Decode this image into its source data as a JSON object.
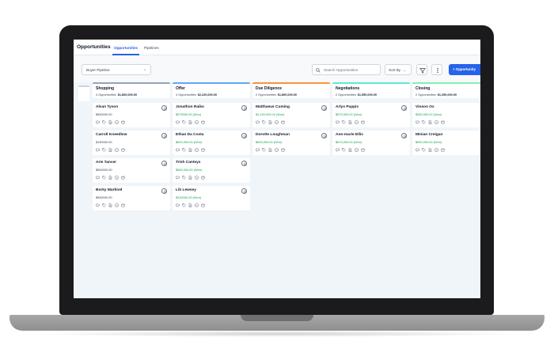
{
  "app": {
    "title": "Opportunities",
    "tabs": [
      {
        "label": "Opportunities",
        "active": true
      },
      {
        "label": "Pipelines",
        "active": false
      }
    ]
  },
  "toolbar": {
    "pipeline_select": "Buyer Pipeline",
    "search_placeholder": "Search Opportunities",
    "sort_label": "Sort By",
    "primary_label": "+ Opportunity"
  },
  "colors": {
    "accent": "#2563eb",
    "won": "#16a34a"
  },
  "card_icons": [
    "chat-icon",
    "tag-icon",
    "document-icon",
    "checkbox-icon",
    "calendar-icon"
  ],
  "columns": [
    {
      "name": "Shopping",
      "count": "4 Opportunities",
      "total": "$1,800,000.00",
      "color": "#94a3b8",
      "cards": [
        {
          "name": "Alvan Tyson",
          "amount": "$550000.00",
          "won": false
        },
        {
          "name": "Carroll Kneedlow",
          "amount": "$150000.00",
          "won": false
        },
        {
          "name": "Arie Tancer",
          "amount": "$550000.00",
          "won": false
        },
        {
          "name": "Borky Martinel",
          "amount": "$550000.00",
          "won": false
        }
      ]
    },
    {
      "name": "Offer",
      "count": "4 Opportunities",
      "total": "$2,220,000.00",
      "color": "#60a5fa",
      "cards": [
        {
          "name": "Jonathon Raiko",
          "amount": "$575000.00 (Won)",
          "won": true
        },
        {
          "name": "Ethan Da Costa",
          "amount": "$820,000.00 (Won)",
          "won": true
        },
        {
          "name": "Trish Canteys",
          "amount": "$550,000.00 (Won)",
          "won": true
        },
        {
          "name": "Lib Lewsey",
          "amount": "$240000.00 (Won)",
          "won": true
        }
      ]
    },
    {
      "name": "Due Diligence",
      "count": "2 Opportunities",
      "total": "$1,800,000.00",
      "color": "#fb923c",
      "cards": [
        {
          "name": "Matthaeus Cuming",
          "amount": "$1,200,000.00 (Won)",
          "won": true
        },
        {
          "name": "Dorotte Loughman",
          "amount": "$600,000.00 (Won)",
          "won": true
        }
      ]
    },
    {
      "name": "Negotiations",
      "count": "2 Opportunities",
      "total": "$1,550,000.00",
      "color": "#5eead4",
      "cards": [
        {
          "name": "Arlys Pappis",
          "amount": "$875,000.00 (Won)",
          "won": true
        },
        {
          "name": "Ann-marie Ellis",
          "amount": "$675,000.00 (Won)",
          "won": true
        }
      ]
    },
    {
      "name": "Closing",
      "count": "2 Opportunities",
      "total": "$1,250,000.00",
      "color": "#86efac",
      "cards": [
        {
          "name": "Vinson Ox",
          "amount": "$350,000.00 (Won)",
          "won": true
        },
        {
          "name": "Minian Creigan",
          "amount": "$900,000.00 (Won)",
          "won": true
        }
      ]
    }
  ]
}
